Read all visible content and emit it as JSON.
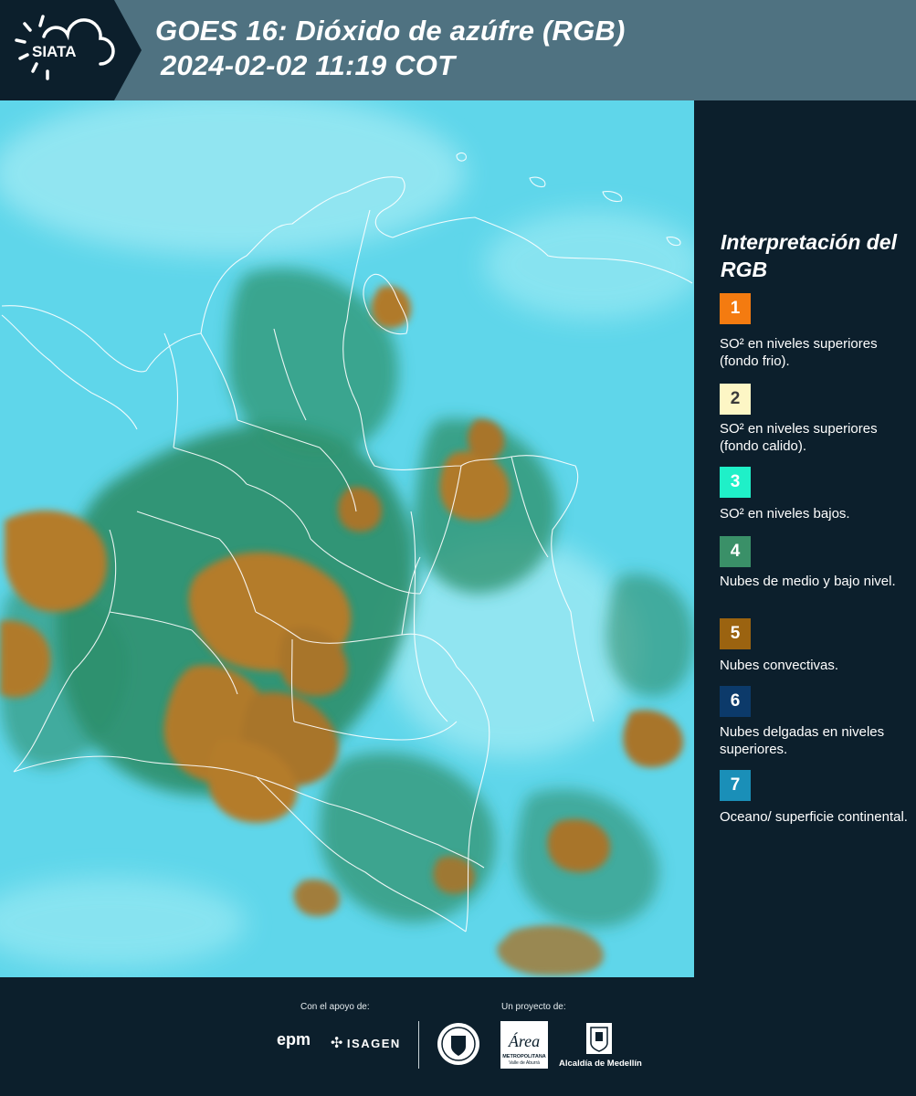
{
  "header": {
    "logo_text": "SIATA",
    "title_line1": "GOES 16: Dióxido de azúfre (RGB)",
    "title_line2": "2024-02-02 11:19 COT",
    "background": "#4f7281"
  },
  "legend": {
    "title": "Interpretación del RGB",
    "items": [
      {
        "number": "1",
        "color": "#f47b10",
        "text": "SO² en niveles superiores (fondo frio)."
      },
      {
        "number": "2",
        "color": "#fdf6c5",
        "text": "SO² en niveles superiores (fondo calido)."
      },
      {
        "number": "3",
        "color": "#1ff0c8",
        "text": "SO² en niveles bajos."
      },
      {
        "number": "4",
        "color": "#3a9068",
        "text": "Nubes de medio y bajo nivel."
      },
      {
        "number": "5",
        "color": "#9b6310",
        "text": "Nubes convectivas."
      },
      {
        "number": "6",
        "color": "#0c3a6a",
        "text": "Nubes delgadas en niveles superiores."
      },
      {
        "number": "7",
        "color": "#1a8fb8",
        "text": "Oceano/ superficie continental."
      }
    ]
  },
  "footer": {
    "support_label": "Con el apoyo de:",
    "project_label": "Un proyecto de:",
    "epm": "epm",
    "isagen": "ISAGEN",
    "area_name": "Área",
    "area_sub1": "METROPOLITANA",
    "area_sub2": "Valle de Aburrá",
    "alcaldia": "Alcaldía de Medellín"
  },
  "map_colors": {
    "background": "#5fd6ea",
    "clear_sky": "#8fe6f2",
    "low_cloud": "#2d8e6a",
    "convective": "#b07a2a",
    "border": "#ffffff"
  }
}
